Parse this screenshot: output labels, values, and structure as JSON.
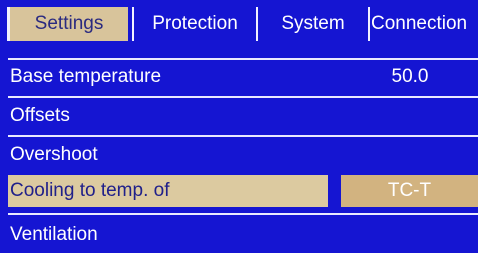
{
  "tabs": [
    {
      "label": "Settings",
      "active": true
    },
    {
      "label": "Protection",
      "active": false
    },
    {
      "label": "System",
      "active": false
    },
    {
      "label": "Connection",
      "active": false
    }
  ],
  "menu": {
    "items": [
      {
        "label": "Base temperature",
        "value": "50.0"
      },
      {
        "label": "Offsets",
        "value": ""
      },
      {
        "label": "Overshoot",
        "value": ""
      },
      {
        "label": "Cooling to temp. of",
        "value": "TC-T"
      },
      {
        "label": "Ventilation",
        "value": ""
      }
    ]
  },
  "colors": {
    "background": "#1515d2",
    "active_tab": "#d8c49b",
    "selected_row_label": "#dccaa0",
    "selected_row_value": "#d2b380",
    "text": "#ffffff"
  }
}
